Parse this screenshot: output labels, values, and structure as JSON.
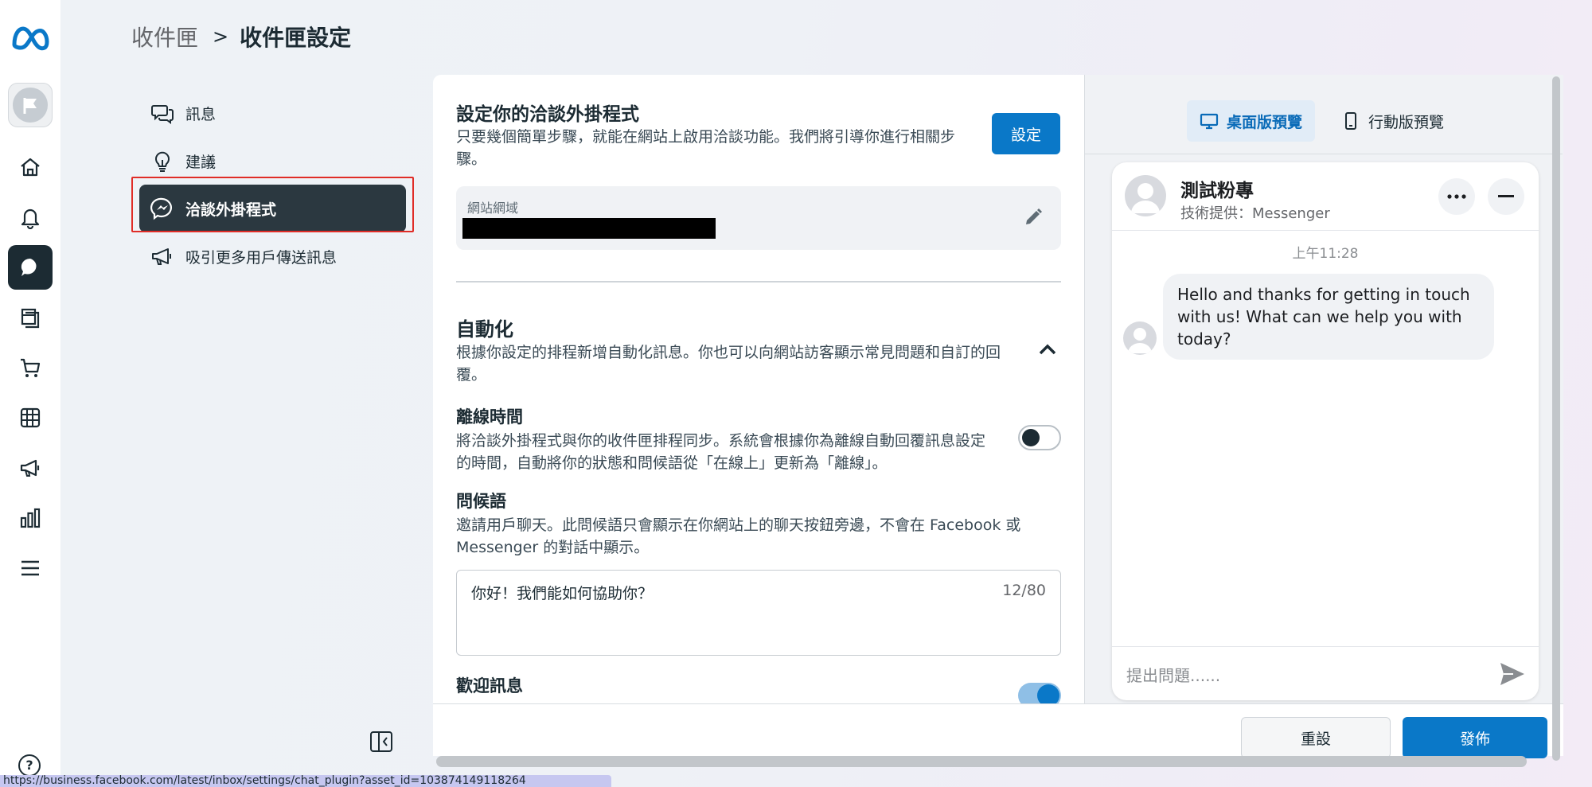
{
  "breadcrumb": {
    "root": "收件匣",
    "separator": ">",
    "current": "收件匣設定"
  },
  "subnav": {
    "items": [
      {
        "label": "訊息",
        "icon": "chat-bubbles-icon"
      },
      {
        "label": "建議",
        "icon": "lightbulb-icon"
      },
      {
        "label": "洽談外掛程式",
        "icon": "messenger-icon",
        "active": true
      },
      {
        "label": "吸引更多用戶傳送訊息",
        "icon": "megaphone-icon"
      }
    ]
  },
  "setup": {
    "title": "設定你的洽談外掛程式",
    "description": "只要幾個簡單步驟，就能在網站上啟用洽談功能。我們將引導你進行相關步驟。",
    "button": "設定",
    "domain_label": "網站網域"
  },
  "automation": {
    "title": "自動化",
    "description": "根據你設定的排程新增自動化訊息。你也可以向網站訪客顯示常見問題和自訂的回覆。"
  },
  "offline": {
    "title": "離線時間",
    "description": "將洽談外掛程式與你的收件匣排程同步。系統會根據你為離線自動回覆訊息設定的時間，自動將你的狀態和問候語從「在線上」更新為「離線」。",
    "enabled": false
  },
  "greeting": {
    "title": "問候語",
    "description": "邀請用戶聊天。此問候語只會顯示在你網站上的聊天按鈕旁邊，不會在 Facebook 或 Messenger 的對話中顯示。",
    "value": "你好！我們能如何協助你？",
    "counter": "12/80"
  },
  "welcome": {
    "title": "歡迎訊息",
    "enabled": true
  },
  "footer": {
    "reset": "重設",
    "publish": "發佈"
  },
  "preview": {
    "desktop_tab": "桌面版預覽",
    "mobile_tab": "行動版預覽",
    "page_name": "測試粉專",
    "powered_by": "技術提供：Messenger",
    "time": "上午11:28",
    "message": "Hello and thanks for getting in touch with us! What can we help you with today?",
    "input_placeholder": "提出問題......"
  },
  "status_url": "https://business.facebook.com/latest/inbox/settings/chat_plugin?asset_id=103874149118264",
  "colors": {
    "accent": "#0a78c8",
    "dark": "#1c2b33",
    "highlight": "#e02d27"
  }
}
